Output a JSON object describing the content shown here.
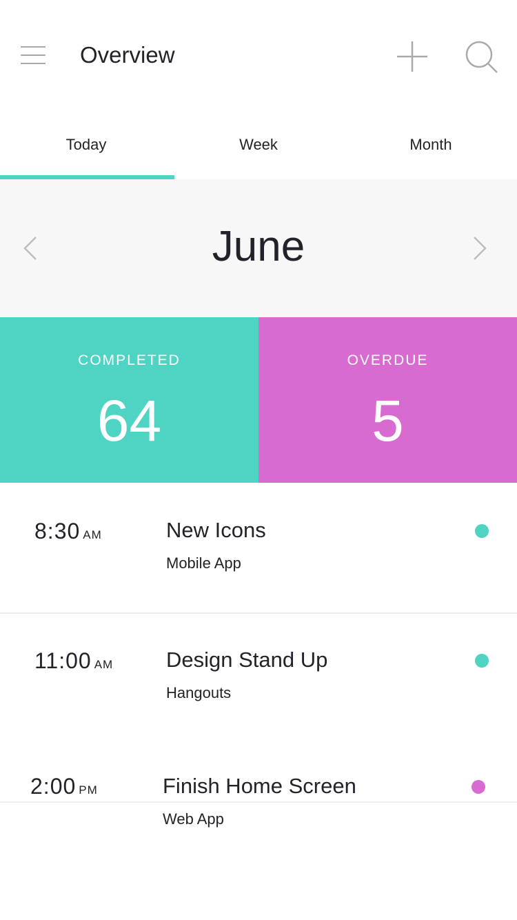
{
  "header": {
    "title": "Overview",
    "menu_icon": "menu-icon",
    "add_icon": "plus-icon",
    "search_icon": "search-icon"
  },
  "tabs": [
    {
      "label": "Today",
      "active": true
    },
    {
      "label": "Week",
      "active": false
    },
    {
      "label": "Month",
      "active": false
    }
  ],
  "month": {
    "title": "June",
    "prev_icon": "chevron-left-icon",
    "next_icon": "chevron-right-icon"
  },
  "stats": {
    "completed": {
      "label": "COMPLETED",
      "value": "64",
      "color": "#4fd3c3"
    },
    "overdue": {
      "label": "OVERDUE",
      "value": "5",
      "color": "#d76bcf"
    }
  },
  "events": [
    {
      "time": "8:30",
      "ampm": "AM",
      "title": "New Icons",
      "subtitle": "Mobile App",
      "dot_color": "#4fd3c3"
    },
    {
      "time": "11:00",
      "ampm": "AM",
      "title": "Design Stand Up",
      "subtitle": "Hangouts",
      "dot_color": "#4fd3c3"
    },
    {
      "time": "2:00",
      "ampm": "PM",
      "title": "Finish Home Screen",
      "subtitle": "Web App",
      "dot_color": "#d76bcf"
    }
  ],
  "colors": {
    "accent_teal": "#4fd3c3",
    "accent_pink": "#d76bcf",
    "text_dark": "#22232a",
    "panel_bg": "#f7f7f7"
  }
}
